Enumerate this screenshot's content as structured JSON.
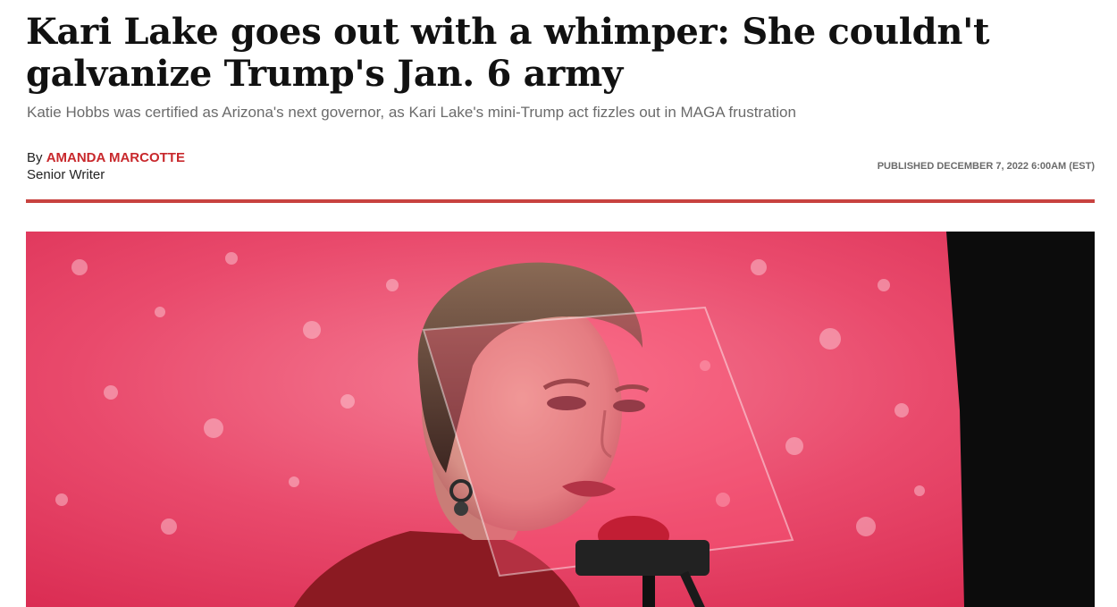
{
  "article": {
    "headline": "Kari Lake goes out with a whimper: She couldn't galvanize Trump's Jan. 6 army",
    "subheadline": "Katie Hobbs was certified as Arizona's next governor, as Kari Lake's mini-Trump act fizzles out in MAGA frustration",
    "byline_prefix": "By",
    "author_name": "AMANDA MARCOTTE",
    "author_role": "Senior Writer",
    "published": "PUBLISHED DECEMBER 7, 2022 6:00AM (EST)"
  },
  "colors": {
    "accent_red": "#c8282c",
    "rule_red": "#c8423f",
    "hero_background_pink": "#e33a5e"
  },
  "hero_image": {
    "description_icon": "photo-of-speaker-at-podium"
  }
}
